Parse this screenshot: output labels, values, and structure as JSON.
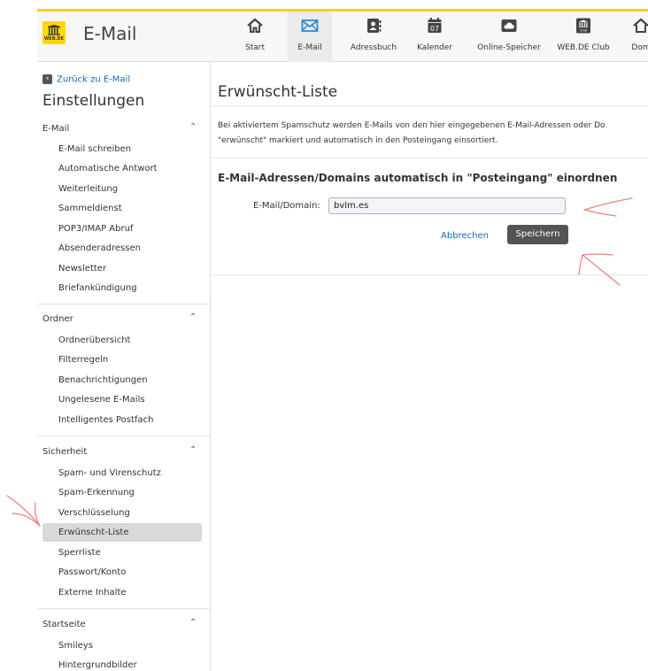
{
  "app": {
    "title": "E-Mail",
    "logo_text": "WEB.DE",
    "accent": "#f5d300",
    "link_color": "#1565c0"
  },
  "nav": [
    {
      "label": "Start",
      "icon": "home-icon"
    },
    {
      "label": "E-Mail",
      "icon": "envelope-icon",
      "active": true
    },
    {
      "label": "Adressbuch",
      "icon": "address-book-icon"
    },
    {
      "label": "Kalender",
      "icon": "calendar-icon",
      "day": "07"
    },
    {
      "label": "Online-Speicher",
      "icon": "cloud-icon"
    },
    {
      "label": "WEB.DE Club",
      "icon": "club-icon",
      "badge": "Club"
    },
    {
      "label": "Dom",
      "icon": "domain-icon"
    }
  ],
  "sidebar": {
    "back_label": "Zurück zu E-Mail",
    "title": "Einstellungen",
    "sections": [
      {
        "label": "E-Mail",
        "items": [
          "E-Mail schreiben",
          "Automatische Antwort",
          "Weiterleitung",
          "Sammeldienst",
          "POP3/IMAP Abruf",
          "Absenderadressen",
          "Newsletter",
          "Briefankündigung"
        ]
      },
      {
        "label": "Ordner",
        "items": [
          "Ordnerübersicht",
          "Filterregeln",
          "Benachrichtigungen",
          "Ungelesene E-Mails",
          "Intelligentes Postfach"
        ]
      },
      {
        "label": "Sicherheit",
        "items": [
          "Spam- und Virenschutz",
          "Spam-Erkennung",
          "Verschlüsselung",
          "Erwünscht-Liste",
          "Sperrliste",
          "Passwort/Konto",
          "Externe Inhalte"
        ]
      },
      {
        "label": "Startseite",
        "items": [
          "Smileys",
          "Hintergrundbilder"
        ]
      }
    ]
  },
  "main": {
    "title": "Erwünscht-Liste",
    "description_line1": "Bei aktiviertem Spamschutz werden E-Mails von den hier eingegebenen E-Mail-Adressen oder Do",
    "description_line2": "\"erwünscht\" markiert und automatisch in den Posteingang einsortiert.",
    "subheading": "E-Mail-Adressen/Domains automatisch in \"Posteingang\" einordnen",
    "field_label": "E-Mail/Domain:",
    "field_value": "bvlm.es",
    "cancel_label": "Abbrechen",
    "save_label": "Speichern"
  },
  "annotation_color": "#e8857a"
}
